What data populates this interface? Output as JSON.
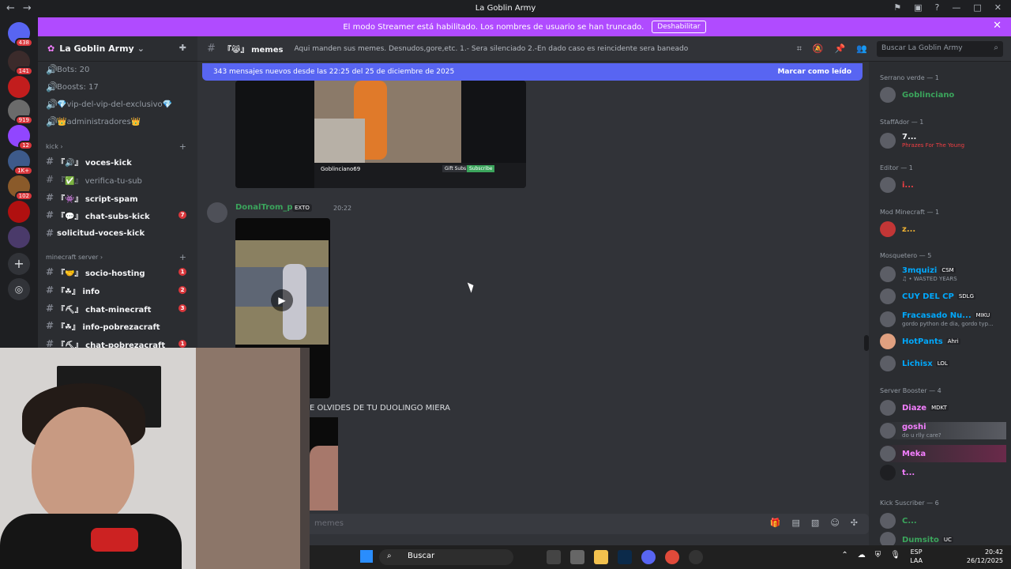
{
  "window": {
    "title": "La Goblin Army"
  },
  "banner": {
    "text": "El modo Streamer está habilitado. Los nombres de usuario se han truncado.",
    "button": "Deshabilitar"
  },
  "servers": [
    {
      "badge": "438"
    },
    {
      "badge": "141"
    },
    {
      "badge": ""
    },
    {
      "badge": "919"
    },
    {
      "badge": "12"
    },
    {
      "badge": "1K+"
    },
    {
      "badge": "102"
    },
    {
      "badge": ""
    },
    {
      "badge": ""
    }
  ],
  "sidebar": {
    "guild_name": "La Goblin Army",
    "top_items": [
      {
        "label": "Bots: 20"
      },
      {
        "label": "Boosts: 17"
      },
      {
        "label": "💎vip-del-vip-del-exclusivo💎"
      },
      {
        "label": "👑administradores👑"
      }
    ],
    "categories": [
      {
        "label": "kick"
      },
      {
        "label": "minecraft server"
      }
    ],
    "kick_channels": [
      {
        "label": "『🔊』 voces-kick",
        "badge": ""
      },
      {
        "label": "『✅』 verifica-tu-sub",
        "badge": ""
      },
      {
        "label": "『👾』 script-spam",
        "badge": ""
      },
      {
        "label": "『💬』 chat-subs-kick",
        "badge": "7"
      },
      {
        "label": "solicitud-voces-kick",
        "badge": ""
      }
    ],
    "mc_channels": [
      {
        "label": "『🤝』 socio-hosting",
        "badge": "1"
      },
      {
        "label": "『☘』 info",
        "badge": "2"
      },
      {
        "label": "『⛏』 chat-minecraft",
        "badge": "3"
      },
      {
        "label": "『☘』 info-pobrezacraft",
        "badge": ""
      },
      {
        "label": "『⛏』 chat-pobrezacraft",
        "badge": "1"
      }
    ]
  },
  "channel": {
    "name": "『😹』 memes",
    "topic": "Aqui manden sus memes. Desnudos,gore,etc. 1.- Sera silenciado 2.-En dado caso es reincidente sera baneado",
    "search_placeholder": "Buscar La Goblin Army"
  },
  "new_messages": {
    "text": "343 mensajes nuevos desde las 22:25 del 25 de diciembre de 2025",
    "mark_read": "Marcar como leído"
  },
  "image1": {
    "streamer": "Goblinciano69",
    "gift": "Gift Subs",
    "subscribe": "Subscribe"
  },
  "message": {
    "author": "DonalTrom_pe",
    "tag": "EXTO",
    "time": "20:22",
    "caption": "E OLVIDES DE TU DUOLINGO MIERA"
  },
  "composer": {
    "placeholder": "memes"
  },
  "members": {
    "groups": [
      {
        "role": "Serrano verde — 1"
      },
      {
        "role": "StaffAdor — 1"
      },
      {
        "role": "Editor — 1"
      },
      {
        "role": "Mod Minecraft — 1"
      },
      {
        "role": "Mosquetero — 5"
      },
      {
        "role": "Server Booster — 4"
      },
      {
        "role": "Kick Suscriber — 6"
      }
    ],
    "list": [
      {
        "name": "Goblinciano",
        "badge": "",
        "status": "",
        "color": "#3ba55c"
      },
      {
        "name": "7...",
        "badge": "",
        "status": "Phrazes For The Young",
        "color": "#f2f3f5"
      },
      {
        "name": "i...",
        "badge": "",
        "status": "",
        "color": "#f23f43"
      },
      {
        "name": "z...",
        "badge": "",
        "status": "",
        "color": "#f0b232"
      },
      {
        "name": "3mquizi",
        "badge": "CSM",
        "status": "♫ • WASTED YEARS",
        "color": "#00a8fc"
      },
      {
        "name": "CUY DEL CP",
        "badge": "SDLG",
        "status": "",
        "color": "#00a8fc"
      },
      {
        "name": "Fracasado Nu...",
        "badge": "MIKU",
        "status": "gordo python de dia, gordo typ...",
        "color": "#00a8fc"
      },
      {
        "name": "HotPants",
        "badge": "Ahri",
        "status": "",
        "color": "#00a8fc"
      },
      {
        "name": "Lichisx",
        "badge": "LOL",
        "status": "",
        "color": "#00a8fc"
      },
      {
        "name": "Diaze",
        "badge": "MDKT",
        "status": "",
        "color": "#f47fff"
      },
      {
        "name": "goshi",
        "badge": "",
        "status": "do u rlly care?",
        "color": "#f47fff"
      },
      {
        "name": "Meka",
        "badge": "",
        "status": "",
        "color": "#f47fff"
      },
      {
        "name": "t...",
        "badge": "",
        "status": "",
        "color": "#f47fff"
      },
      {
        "name": "C...",
        "badge": "",
        "status": "",
        "color": "#3ba55c"
      },
      {
        "name": "Dumsito",
        "badge": "UC",
        "status": "",
        "color": "#3ba55c"
      }
    ]
  },
  "taskbar": {
    "search": "Buscar",
    "lang1": "ESP",
    "lang2": "LAA",
    "time": "20:42",
    "date": "26/12/2025"
  }
}
